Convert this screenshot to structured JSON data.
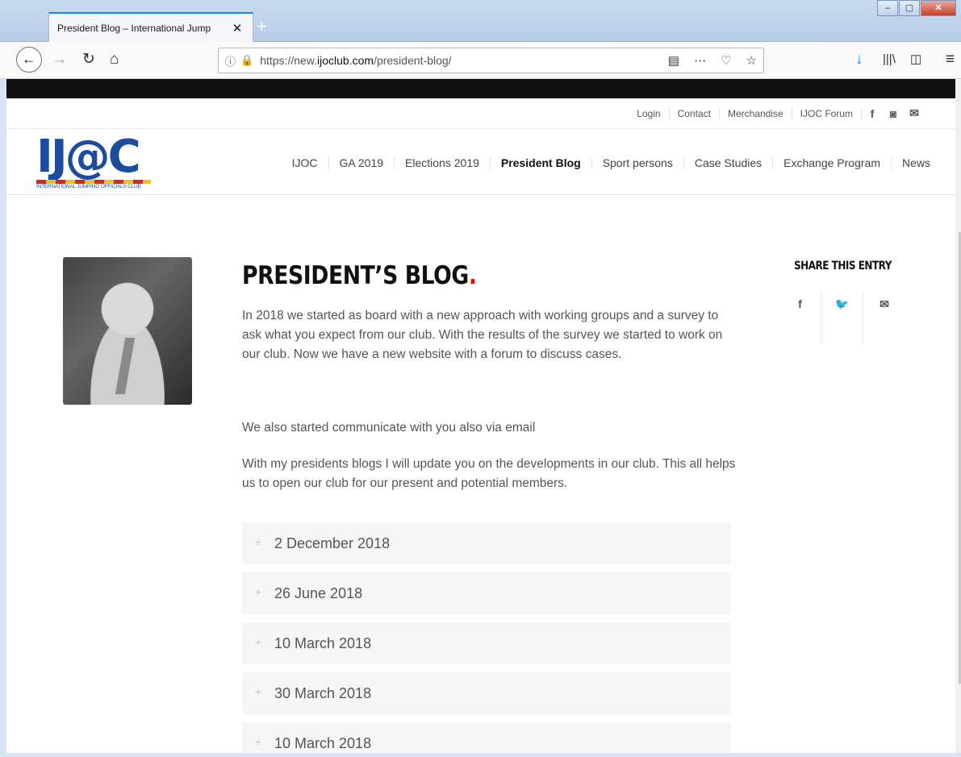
{
  "browser": {
    "tab_title": "President Blog – International Jump",
    "tab_close": "✕",
    "new_tab": "+",
    "url_prefix": "https://new.",
    "url_domain": "ijoclub.com",
    "url_path": "/president-blog/",
    "win_min": "–",
    "win_max": "▢",
    "win_close": "✕"
  },
  "site": {
    "top_links": [
      "Login",
      "Contact",
      "Merchandise",
      "IJOC Forum"
    ],
    "social": [
      "f",
      "◙",
      "✉"
    ],
    "logo_letters": "IJ@C",
    "logo_sub": "INTERNATIONAL JUMPING OFFICIALS CLUB",
    "nav": [
      "IJOC",
      "GA 2019",
      "Elections 2019",
      "President Blog",
      "Sport persons",
      "Case Studies",
      "Exchange Program",
      "News"
    ],
    "nav_active": "President Blog"
  },
  "post": {
    "title": "PRESIDENT’S BLOG",
    "title_dot": ".",
    "para1": "In 2018 we started as board with a new approach with working groups and a survey to ask what you expect from our club. With the results of the survey we started to work on our club. Now we have a new website with a forum to discuss cases.",
    "para2": "We also started communicate with you also via email",
    "para3": "With my presidents blogs I will update you on the developments in our club. This all helps us to open our club for our present and potential members.",
    "accordion": [
      "2 December 2018",
      "26 June 2018",
      "10 March 2018",
      "30 March 2018",
      "10 March 2018"
    ]
  },
  "share": {
    "title": "SHARE THIS ENTRY",
    "icons": [
      "f",
      "🐦",
      "✉"
    ]
  },
  "colors": {
    "accent_red": "#e00000",
    "logo_blue": "#1c4d9c",
    "firefox_blue": "#0a84ff"
  }
}
